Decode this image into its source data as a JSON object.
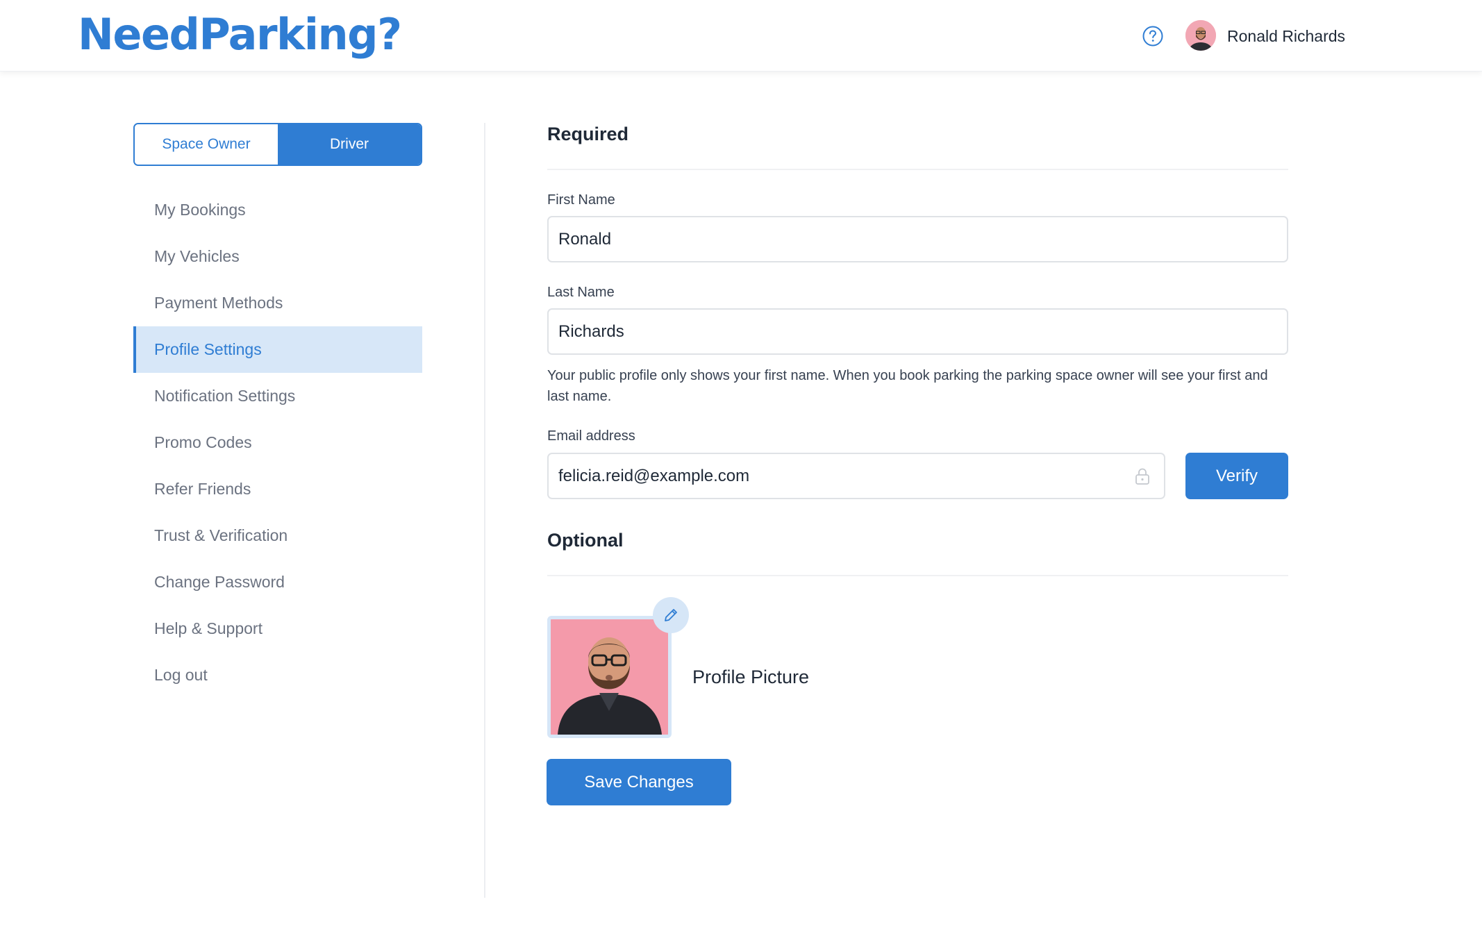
{
  "header": {
    "logo": "NeedParking?",
    "help_icon": "question-circle-icon",
    "user_name": "Ronald Richards"
  },
  "sidebar": {
    "roles": [
      {
        "label": "Space Owner",
        "active": false
      },
      {
        "label": "Driver",
        "active": true
      }
    ],
    "items": [
      {
        "label": "My Bookings"
      },
      {
        "label": "My Vehicles"
      },
      {
        "label": "Payment Methods"
      },
      {
        "label": "Profile Settings",
        "active": true
      },
      {
        "label": "Notification Settings"
      },
      {
        "label": "Promo Codes"
      },
      {
        "label": "Refer Friends"
      },
      {
        "label": "Trust & Verification"
      },
      {
        "label": "Change Password"
      },
      {
        "label": "Help & Support"
      },
      {
        "label": "Log out"
      }
    ]
  },
  "form": {
    "required_title": "Required",
    "first_name_label": "First Name",
    "first_name_value": "Ronald",
    "last_name_label": "Last Name",
    "last_name_value": "Richards",
    "help_text": "Your public profile only shows your first name. When you book parking the parking space owner will see your first and last name.",
    "email_label": "Email address",
    "email_value": "felicia.reid@example.com",
    "email_icon": "lock-icon",
    "verify_label": "Verify",
    "optional_title": "Optional",
    "edit_icon": "pencil-icon",
    "profile_picture_label": "Profile Picture",
    "save_label": "Save Changes"
  },
  "colors": {
    "brand": "#2f7dd3",
    "active_bg": "#d7e7f8",
    "muted_text": "#6b7280"
  }
}
